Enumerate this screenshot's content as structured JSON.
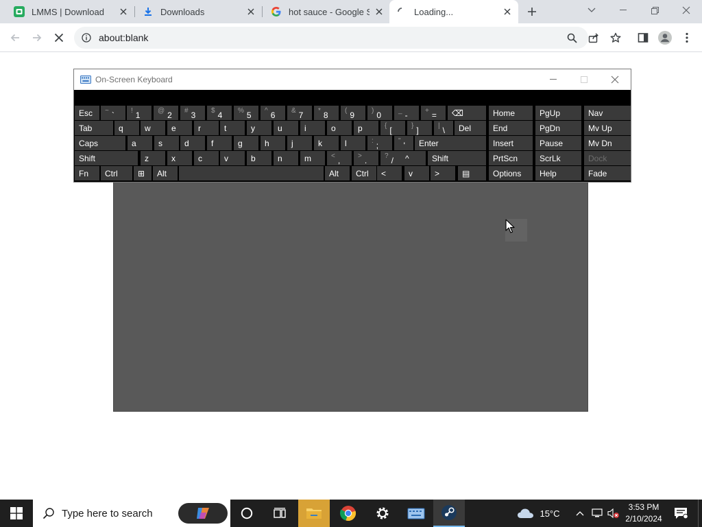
{
  "browser": {
    "tabs": [
      {
        "title": "LMMS | Download",
        "icon": "lmms-icon"
      },
      {
        "title": "Downloads",
        "icon": "download-icon"
      },
      {
        "title": "hot sauce - Google Sea",
        "icon": "google-icon"
      },
      {
        "title": "Loading...",
        "icon": "loading-spinner-icon",
        "active": true
      }
    ],
    "url": "about:blank"
  },
  "osk": {
    "title": "On-Screen Keyboard",
    "rows": [
      [
        {
          "main": "Esc"
        },
        {
          "shift": "~",
          "main": "`"
        },
        {
          "shift": "!",
          "main": "1"
        },
        {
          "shift": "@",
          "main": "2"
        },
        {
          "shift": "#",
          "main": "3"
        },
        {
          "shift": "$",
          "main": "4"
        },
        {
          "shift": "%",
          "main": "5"
        },
        {
          "shift": "^",
          "main": "6"
        },
        {
          "shift": "&",
          "main": "7"
        },
        {
          "shift": "*",
          "main": "8"
        },
        {
          "shift": "(",
          "main": "9"
        },
        {
          "shift": ")",
          "main": "0"
        },
        {
          "shift": "_",
          "main": "-"
        },
        {
          "shift": "+",
          "main": "="
        },
        {
          "main": "⌫"
        }
      ],
      [
        {
          "main": "Tab"
        },
        {
          "main": "q"
        },
        {
          "main": "w"
        },
        {
          "main": "e"
        },
        {
          "main": "r"
        },
        {
          "main": "t"
        },
        {
          "main": "y"
        },
        {
          "main": "u"
        },
        {
          "main": "i"
        },
        {
          "main": "o"
        },
        {
          "main": "p"
        },
        {
          "shift": "{",
          "main": "["
        },
        {
          "shift": "}",
          "main": "]"
        },
        {
          "shift": "|",
          "main": "\\"
        },
        {
          "main": "Del"
        }
      ],
      [
        {
          "main": "Caps"
        },
        {
          "main": "a"
        },
        {
          "main": "s"
        },
        {
          "main": "d"
        },
        {
          "main": "f"
        },
        {
          "main": "g"
        },
        {
          "main": "h"
        },
        {
          "main": "j"
        },
        {
          "main": "k"
        },
        {
          "main": "l"
        },
        {
          "shift": ":",
          "main": ";"
        },
        {
          "shift": "\"",
          "main": "'"
        },
        {
          "main": "Enter"
        }
      ],
      [
        {
          "main": "Shift"
        },
        {
          "main": "z"
        },
        {
          "main": "x"
        },
        {
          "main": "c"
        },
        {
          "main": "v"
        },
        {
          "main": "b"
        },
        {
          "main": "n"
        },
        {
          "main": "m"
        },
        {
          "shift": "<",
          "main": ","
        },
        {
          "shift": ">",
          "main": "."
        },
        {
          "shift": "?",
          "main": "/"
        },
        {
          "main": "^"
        },
        {
          "main": "Shift"
        }
      ],
      [
        {
          "main": "Fn"
        },
        {
          "main": "Ctrl"
        },
        {
          "main": "⊞"
        },
        {
          "main": "Alt"
        },
        {
          "main": ""
        },
        {
          "main": "Alt"
        },
        {
          "main": "Ctrl"
        },
        {
          "main": "<"
        },
        {
          "main": "v"
        },
        {
          "main": ">"
        },
        {
          "main": "▤"
        }
      ]
    ],
    "nav": [
      [
        "Home",
        "PgUp",
        "Nav"
      ],
      [
        "End",
        "PgDn",
        "Mv Up"
      ],
      [
        "Insert",
        "Pause",
        "Mv Dn"
      ],
      [
        "PrtScn",
        "ScrLk",
        "Dock"
      ],
      [
        "Options",
        "Help",
        "Fade"
      ]
    ]
  },
  "taskbar": {
    "search_placeholder": "Type here to search",
    "weather": "15°C",
    "time": "3:53 PM",
    "date": "2/10/2024"
  },
  "colors": {
    "osk_bg": "#000000",
    "osk_key": "#3a3a3a",
    "taskbar_bg": "#1f1f1f",
    "tabstrip_bg": "#dee1e6"
  }
}
